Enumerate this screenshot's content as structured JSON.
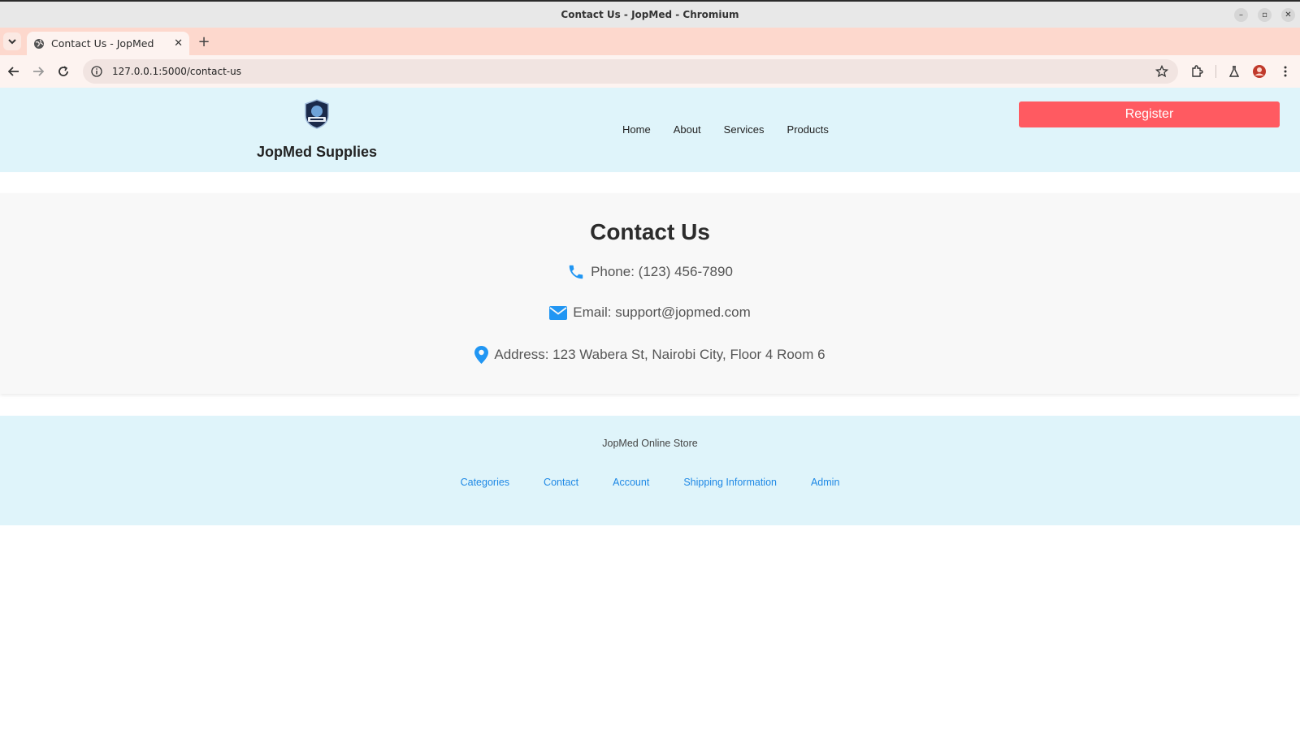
{
  "window": {
    "title": "Contact Us - JopMed - Chromium",
    "controls": {
      "minimize": "–",
      "restore": "▫",
      "close": "✕"
    }
  },
  "tabs": [
    {
      "title": "Contact Us - JopMed",
      "close": "✕",
      "icon": "globe-icon"
    }
  ],
  "toolbar": {
    "new_tab": "+",
    "url": "127.0.0.1:5000/contact-us"
  },
  "header": {
    "brand_name": "JopMed Supplies",
    "nav": [
      "Home",
      "About",
      "Services",
      "Products"
    ],
    "register": "Register"
  },
  "contact": {
    "title": "Contact Us",
    "phone": "Phone: (123) 456-7890",
    "email": "Email: support@jopmed.com",
    "address": "Address: 123 Wabera St, Nairobi City, Floor 4 Room 6",
    "icon_color": "#2196f3"
  },
  "footer": {
    "title": "JopMed Online Store",
    "links": [
      "Categories",
      "Contact",
      "Account",
      "Shipping Information",
      "Admin"
    ]
  },
  "colors": {
    "header_bg": "#dff4fa",
    "register_bg": "#ff5a61",
    "link": "#1e88e5"
  }
}
